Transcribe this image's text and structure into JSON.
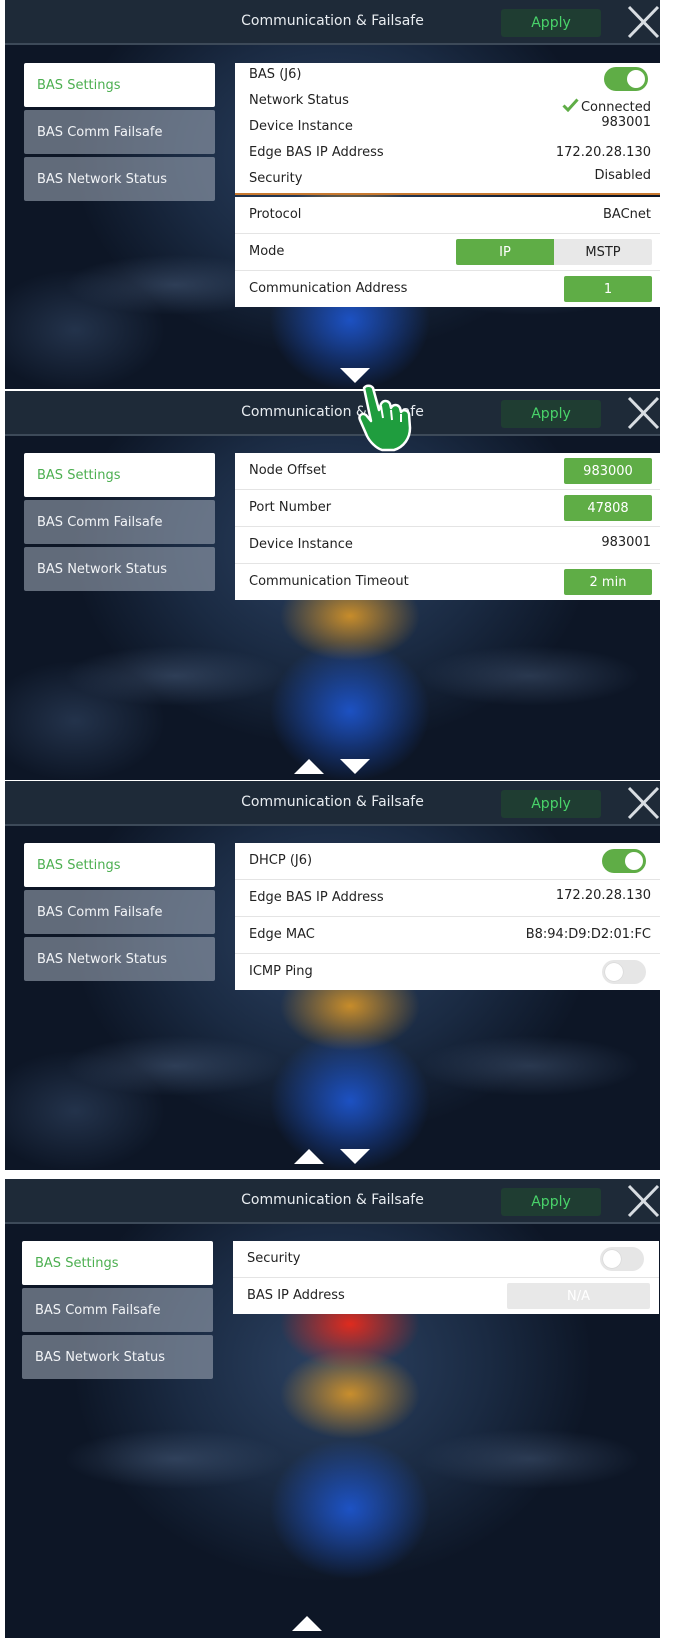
{
  "header": {
    "title": "Communication & Failsafe",
    "apply_label": "Apply"
  },
  "sidebar": {
    "items": [
      {
        "label": "BAS Settings",
        "active": true
      },
      {
        "label": "BAS Comm Failsafe",
        "active": false
      },
      {
        "label": "BAS Network Status",
        "active": false
      }
    ]
  },
  "screen1": {
    "status_card": {
      "bas_label": "BAS (J6)",
      "bas_enabled": true,
      "network_status_label": "Network Status",
      "network_status_value": "Connected",
      "device_instance_label": "Device Instance",
      "device_instance_value": "983001",
      "edge_ip_label": "Edge BAS IP Address",
      "edge_ip_value": "172.20.28.130",
      "security_label": "Security",
      "security_value": "Disabled"
    },
    "settings": {
      "protocol_label": "Protocol",
      "protocol_value": "BACnet",
      "mode_label": "Mode",
      "mode_options": [
        "IP",
        "MSTP"
      ],
      "mode_selected": "IP",
      "comm_address_label": "Communication Address",
      "comm_address_value": "1"
    }
  },
  "screen2": {
    "node_offset_label": "Node Offset",
    "node_offset_value": "983000",
    "port_number_label": "Port Number",
    "port_number_value": "47808",
    "device_instance_label": "Device Instance",
    "device_instance_value": "983001",
    "comm_timeout_label": "Communication Timeout",
    "comm_timeout_value": "2 min"
  },
  "screen3": {
    "dhcp_label": "DHCP (J6)",
    "dhcp_enabled": true,
    "edge_ip_label": "Edge BAS IP Address",
    "edge_ip_value": "172.20.28.130",
    "edge_mac_label": "Edge MAC",
    "edge_mac_value": "B8:94:D9:D2:01:FC",
    "icmp_label": "ICMP Ping",
    "icmp_enabled": false
  },
  "screen4": {
    "security_label": "Security",
    "security_enabled": false,
    "bas_ip_label": "BAS IP Address",
    "bas_ip_value": "N/A"
  },
  "colors": {
    "accent_green": "#5fad46",
    "apply_text": "#49d36a",
    "header_bg": "#1e2a38"
  },
  "icons": [
    "close-icon",
    "checkmark-icon",
    "arrow-down-icon",
    "arrow-up-icon",
    "hand-pointer-icon"
  ]
}
